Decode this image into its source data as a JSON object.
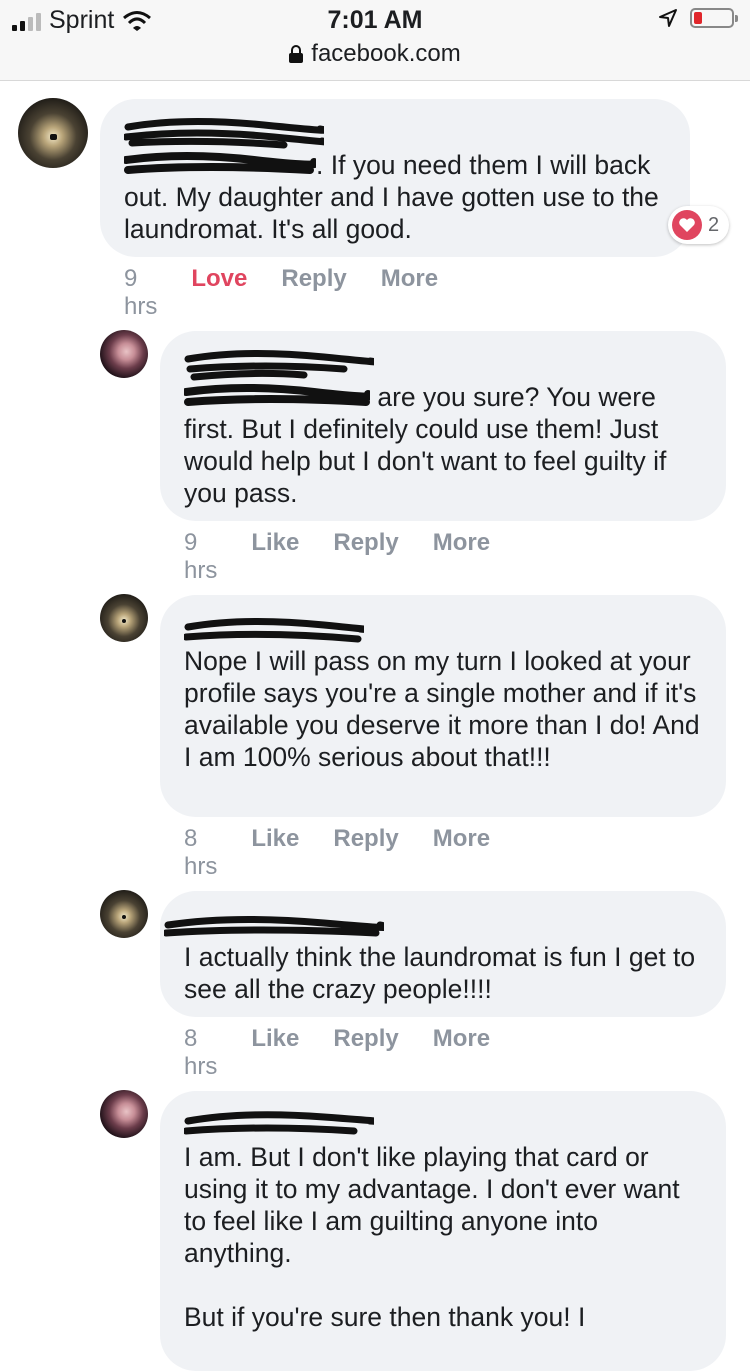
{
  "status_bar": {
    "carrier": "Sprint",
    "time": "7:01 AM",
    "url": "facebook.com"
  },
  "comments": [
    {
      "author": "",
      "text": ". If you need them I will back out. My daughter and I have gotten use to the laundromat. It's all good.",
      "time": "9 hrs",
      "like_label": "Love",
      "reply_label": "Reply",
      "more_label": "More",
      "reactions": {
        "icon": "heart-icon",
        "count": "2"
      }
    },
    {
      "author": "",
      "text": " are you sure? You were first. But I definitely could use them! Just would help but I don't want to feel guilty if you pass.",
      "time": "9 hrs",
      "like_label": "Like",
      "reply_label": "Reply",
      "more_label": "More"
    },
    {
      "author": "",
      "text": "Nope I will pass on my turn I looked at your profile says you're a single mother and if it's available you deserve it more than I do! And I am 100% serious about that!!!",
      "time": "8 hrs",
      "like_label": "Like",
      "reply_label": "Reply",
      "more_label": "More"
    },
    {
      "author": "",
      "text": "I actually think the laundromat is fun I get to see all the crazy people!!!!",
      "time": "8 hrs",
      "like_label": "Like",
      "reply_label": "Reply",
      "more_label": "More"
    },
    {
      "author": "",
      "text": "I am. But I don't like playing that card or using it to my advantage. I don't ever want to feel like I am guilting anyone into anything.\n\nBut if you're sure then thank you! I",
      "time": "",
      "like_label": "",
      "reply_label": "",
      "more_label": ""
    }
  ],
  "colors": {
    "bubble": "#f0f2f5",
    "love": "#e0455f",
    "meta": "#8d949e",
    "battery_low": "#e0262b"
  }
}
